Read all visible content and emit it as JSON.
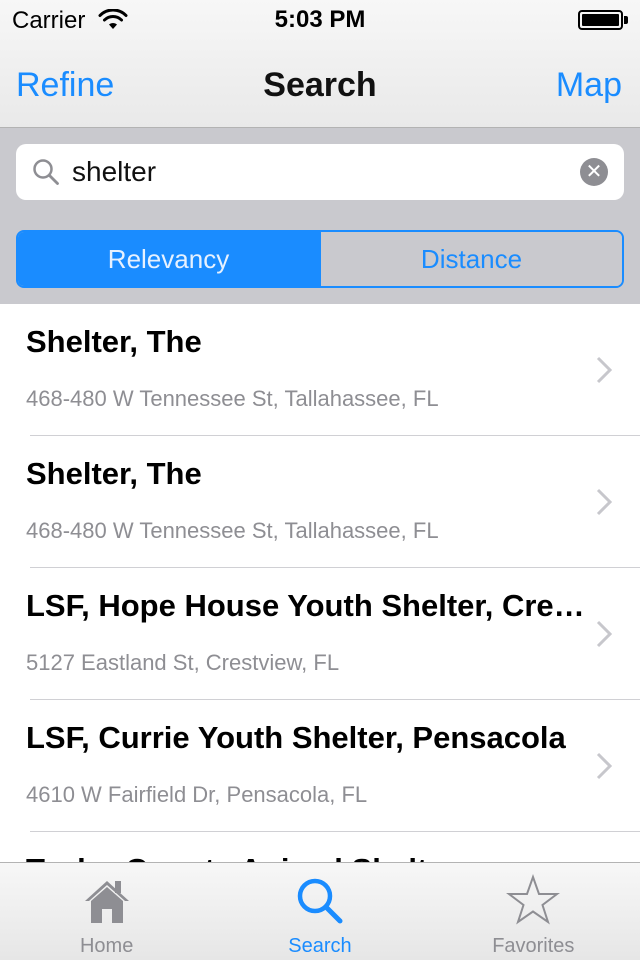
{
  "status_bar": {
    "carrier": "Carrier",
    "time": "5:03 PM"
  },
  "nav": {
    "left_button": "Refine",
    "title": "Search",
    "right_button": "Map"
  },
  "search": {
    "value": "shelter"
  },
  "segments": {
    "relevancy": "Relevancy",
    "distance": "Distance",
    "selected": "Relevancy"
  },
  "results": [
    {
      "title": "Shelter, The",
      "address": "468-480 W Tennessee St, Tallahassee, FL"
    },
    {
      "title": "Shelter, The",
      "address": "468-480 W Tennessee St, Tallahassee, FL"
    },
    {
      "title": "LSF, Hope House Youth Shelter, Crestview",
      "address": "5127 Eastland St, Crestview, FL"
    },
    {
      "title": "LSF, Currie Youth Shelter, Pensacola",
      "address": "4610 W Fairfield Dr, Pensacola, FL"
    },
    {
      "title": "Taylor County Animal Shelter",
      "address": ""
    }
  ],
  "tabs": [
    {
      "label": "Home",
      "icon": "home-icon"
    },
    {
      "label": "Search",
      "icon": "search-icon"
    },
    {
      "label": "Favorites",
      "icon": "star-icon"
    }
  ],
  "colors": {
    "accent": "#1a8cff",
    "secondary_text": "#8e8e93",
    "search_background": "#c9c9ce"
  }
}
